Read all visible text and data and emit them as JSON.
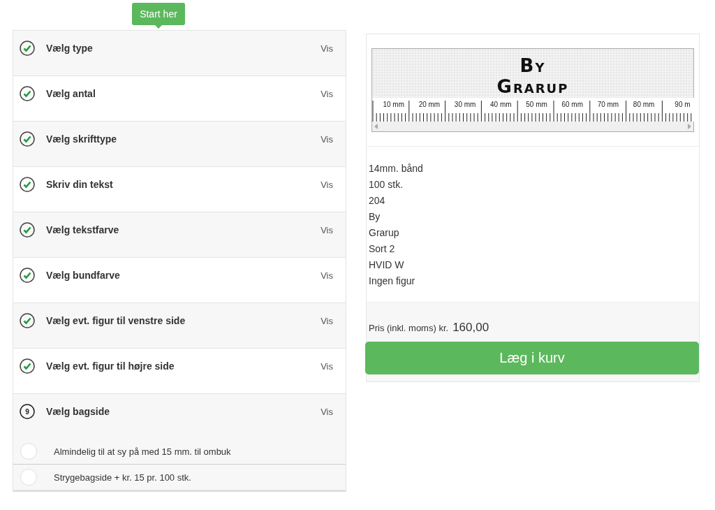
{
  "tooltip": "Start her",
  "steps": [
    {
      "title": "Vælg type",
      "done": true,
      "action": "Vis"
    },
    {
      "title": "Vælg antal",
      "done": true,
      "action": "Vis"
    },
    {
      "title": "Vælg skrifttype",
      "done": true,
      "action": "Vis"
    },
    {
      "title": "Skriv din tekst",
      "done": true,
      "action": "Vis"
    },
    {
      "title": "Vælg tekstfarve",
      "done": true,
      "action": "Vis"
    },
    {
      "title": "Vælg bundfarve",
      "done": true,
      "action": "Vis"
    },
    {
      "title": "Vælg evt. figur til venstre side",
      "done": true,
      "action": "Vis"
    },
    {
      "title": "Vælg evt. figur til højre side",
      "done": true,
      "action": "Vis"
    },
    {
      "title": "Vælg bagside",
      "done": false,
      "number": "9",
      "action": "Vis",
      "options": [
        {
          "label": "Almindelig til at sy på med 15 mm. til ombuk",
          "selected": false
        },
        {
          "label": "Strygebagside + kr. 15 pr. 100 stk.",
          "selected": false
        }
      ]
    }
  ],
  "preview": {
    "lines": [
      "By",
      "Grarup"
    ],
    "ruler_labels": [
      "10 mm",
      "20 mm",
      "30 mm",
      "40 mm",
      "50 mm",
      "60 mm",
      "70 mm",
      "80 mm",
      "90 m"
    ]
  },
  "summary": [
    "14mm. bånd",
    "100 stk.",
    "204",
    "By",
    "Grarup",
    "Sort 2",
    "HVID W",
    "Ingen figur"
  ],
  "price": {
    "label": "Pris (inkl. moms) kr.",
    "value": "160,00"
  },
  "cart_button": "Læg i kurv"
}
